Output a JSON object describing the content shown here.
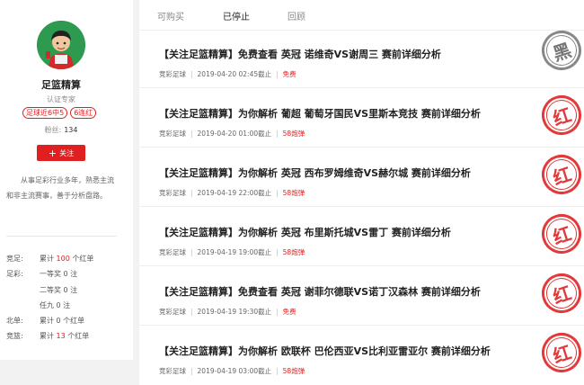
{
  "profile": {
    "name": "足篮精算",
    "role": "认证专家",
    "badge_recent": "足球近6中5",
    "badge_streak": "6连红",
    "fans_label": "粉丝:",
    "fans_count": "134",
    "follow_label": "关注",
    "intro": "从事足彩行业多年，熟悉主流和非主流赛事，善于分析盘路。",
    "stats": {
      "jingzu": {
        "label": "竞足:",
        "pre": "累计",
        "value": "100",
        "post": "个红单"
      },
      "zucai": {
        "label": "足彩:",
        "items": [
          "一等奖 0 注",
          "二等奖 0 注",
          "任九 0 注"
        ]
      },
      "beidan": {
        "label": "北单:",
        "text": "累计 0 个红单"
      },
      "jinglan": {
        "label": "竞篮:",
        "pre": "累计",
        "value": "13",
        "post": "个红单"
      }
    }
  },
  "tabs": [
    "可购买",
    "已停止",
    "回顾"
  ],
  "active_tab": "已停止",
  "items": [
    {
      "title": "【关注足篮精算】免费查看 英冠 诺维奇VS谢周三 赛前详细分析",
      "category": "竞彩足球",
      "time": "2019-04-20 02:45截止",
      "price": "免费",
      "stamp": "黑"
    },
    {
      "title": "【关注足篮精算】为你解析 葡超 葡萄牙国民VS里斯本竞技 赛前详细分析",
      "category": "竞彩足球",
      "time": "2019-04-20 01:00截止",
      "price": "58炮弹",
      "stamp": "红"
    },
    {
      "title": "【关注足篮精算】为你解析 英冠 西布罗姆维奇VS赫尔城 赛前详细分析",
      "category": "竞彩足球",
      "time": "2019-04-19 22:00截止",
      "price": "58炮弹",
      "stamp": "红"
    },
    {
      "title": "【关注足篮精算】为你解析 英冠 布里斯托城VS雷丁 赛前详细分析",
      "category": "竞彩足球",
      "time": "2019-04-19 19:00截止",
      "price": "58炮弹",
      "stamp": "红"
    },
    {
      "title": "【关注足篮精算】免费查看 英冠 谢菲尔德联VS诺丁汉森林 赛前详细分析",
      "category": "竞彩足球",
      "time": "2019-04-19 19:30截止",
      "price": "免费",
      "stamp": "红"
    },
    {
      "title": "【关注足篮精算】为你解析 欧联杯 巴伦西亚VS比利亚雷亚尔 赛前详细分析",
      "category": "竞彩足球",
      "time": "2019-04-19 03:00截止",
      "price": "58炮弹",
      "stamp": "红"
    }
  ]
}
